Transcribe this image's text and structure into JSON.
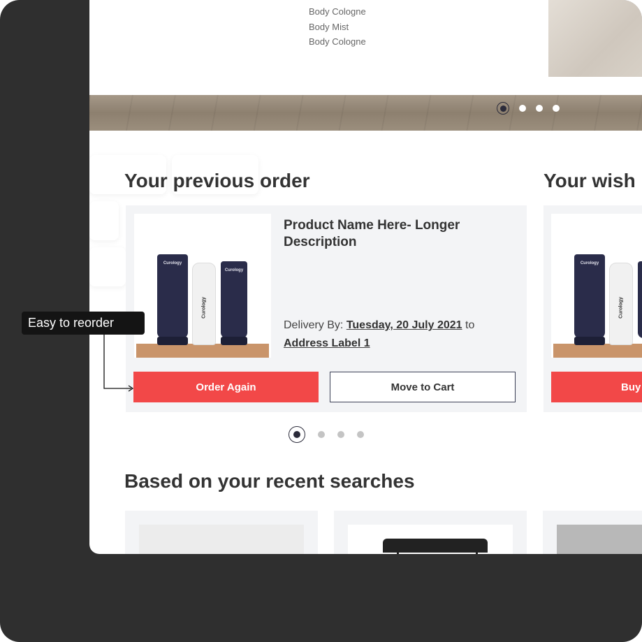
{
  "hero": {
    "list": [
      "Body Cologne",
      "Body Mist",
      "Body Cologne"
    ],
    "dots": 4,
    "active_dot": 0
  },
  "previous_order": {
    "title": "Your previous order",
    "product_name": "Product Name Here- Longer Description",
    "delivery_prefix": "Delivery By:",
    "delivery_date": "Tuesday, 20 July 2021",
    "delivery_to": "to",
    "address_label": "Address Label 1",
    "order_again_label": "Order Again",
    "move_to_cart_label": "Move to Cart",
    "product_brand": "Curology"
  },
  "wishlist": {
    "title": "Your wish",
    "buy_label": "Buy"
  },
  "recent_searches": {
    "title": "Based on your recent searches"
  },
  "annotation": {
    "label": "Easy to reorder"
  },
  "colors": {
    "accent": "#f24848",
    "frame": "#2f2f2f",
    "card_bg": "#f3f4f6"
  }
}
